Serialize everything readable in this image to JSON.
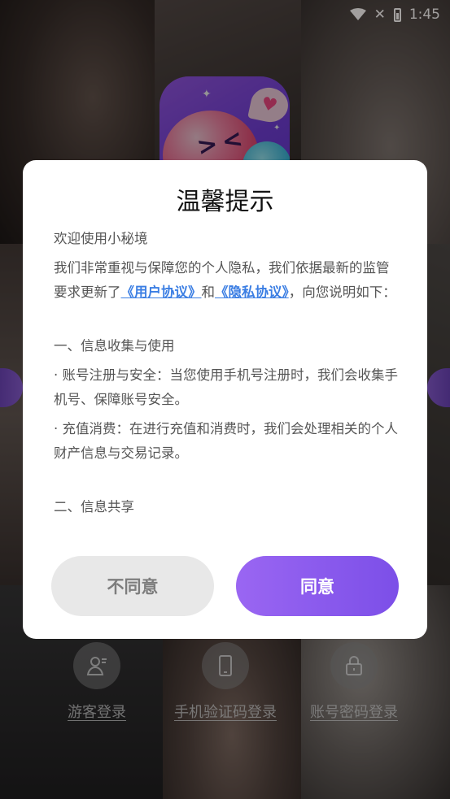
{
  "status_bar": {
    "time": "1:45"
  },
  "app": {
    "name": "小秘境"
  },
  "dialog": {
    "title": "温馨提示",
    "welcome": "欢迎使用小秘境",
    "intro_before": "我们非常重视与保障您的个人隐私，我们依据最新的监管要求更新了",
    "link_user_agreement": "《用户协议》",
    "intro_and": "和",
    "link_privacy_agreement": "《隐私协议》",
    "intro_after": "，向您说明如下：",
    "section1_heading": "一、信息收集与使用",
    "item1": "· 账号注册与安全：当您使用手机号注册时，我们会收集手机号、保障账号安全。",
    "item2": "· 充值消费：在进行充值和消费时，我们会处理相关的个人财产信息与交易记录。",
    "section2_heading": "二、信息共享",
    "btn_disagree": "不同意",
    "btn_agree": "同意"
  },
  "login_options": [
    {
      "label": "游客登录",
      "icon": "guest-icon"
    },
    {
      "label": "手机验证码登录",
      "icon": "phone-icon"
    },
    {
      "label": "账号密码登录",
      "icon": "lock-icon"
    }
  ],
  "colors": {
    "accent_purple": "#8a5bef",
    "link_blue": "#3b7ee3",
    "disagree_bg": "#e8e8e8"
  }
}
